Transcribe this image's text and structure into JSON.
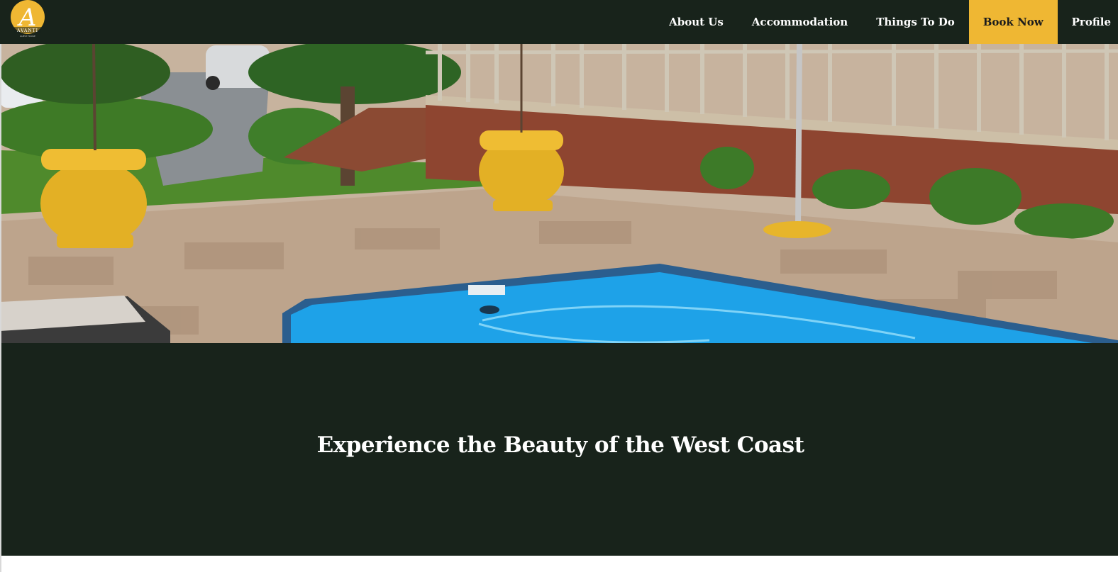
{
  "brand": {
    "logo_letter": "A",
    "logo_name": "AVANTI",
    "logo_tagline": "GUEST HOUSE",
    "logo_icon": "avanti-monogram-logo"
  },
  "nav": {
    "items": [
      {
        "label": "About Us"
      },
      {
        "label": "Accommodation"
      },
      {
        "label": "Things To Do"
      },
      {
        "label": "Book Now"
      },
      {
        "label": "Profile"
      }
    ]
  },
  "hero": {
    "image": "pool-patio-photo"
  },
  "banner": {
    "title": "Experience the Beauty of the West Coast"
  },
  "colors": {
    "nav_bg": "#18231b",
    "accent": "#efb733",
    "text_light": "#ffffff",
    "pool_blue": "#1ea2e8"
  }
}
